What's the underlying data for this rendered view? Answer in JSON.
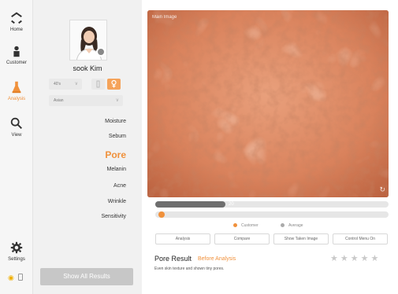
{
  "nav": {
    "items": [
      {
        "label": "Home",
        "icon": "home-icon"
      },
      {
        "label": "Customer",
        "icon": "customer-icon"
      },
      {
        "label": "Analysis",
        "icon": "analysis-icon",
        "active": true
      },
      {
        "label": "View",
        "icon": "search-icon"
      }
    ],
    "settings_label": "Settings",
    "status": {
      "wifi": "wifi-icon",
      "battery": "battery-icon"
    }
  },
  "profile": {
    "name": "sook Kim",
    "age_select": "40's",
    "ethnicity_select": "Asian"
  },
  "menu": {
    "items": [
      "Moisture",
      "Sebum",
      "Pore",
      "Melanin",
      "Acne",
      "Wrinkle",
      "Sensitivity"
    ],
    "active": "Pore"
  },
  "show_all_label": "Show All Results",
  "image": {
    "tag": "Main Image"
  },
  "score": {
    "customer_value": "20",
    "customer_fraction": 0.3
  },
  "legend": {
    "customer": "Customer",
    "average": "Average"
  },
  "buttons": {
    "analysis": "Analysis",
    "compare": "Compare",
    "show_taken": "Show Taken Image",
    "control_menu": "Control Menu On"
  },
  "result": {
    "title": "Pore Result",
    "subtitle": "Before Analysis",
    "description": "Even skin texture and shown tiny pores.",
    "stars_total": 5,
    "stars_filled": 0
  },
  "colors": {
    "accent": "#f0913c",
    "skin": "#d77a52"
  }
}
